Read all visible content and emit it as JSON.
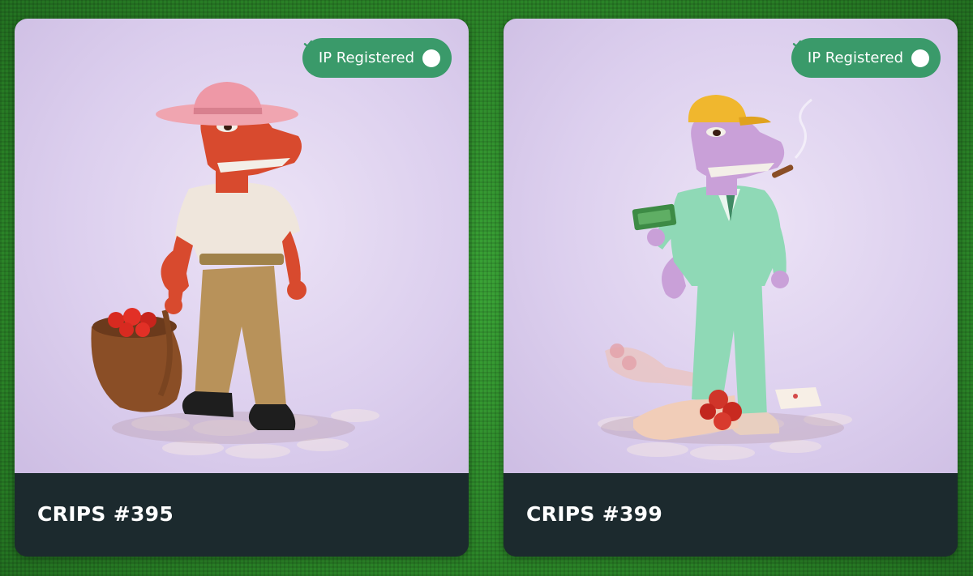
{
  "cards": [
    {
      "name": "CRIPS #395",
      "badge": {
        "label": "IP Registered",
        "icon": "check-circle-icon"
      },
      "character": {
        "skin_color": "#d84a2e",
        "outfit_color": "#efe6dc",
        "hat_color": "#f0a5b0"
      }
    },
    {
      "name": "CRIPS #399",
      "badge": {
        "label": "IP Registered",
        "icon": "check-circle-icon"
      },
      "character": {
        "skin_color": "#c9a0d8",
        "outfit_color": "#8fd9b6",
        "hat_color": "#f0b72e"
      }
    }
  ],
  "colors": {
    "background": "#2f8f2c",
    "card_footer": "#1c2a2e",
    "badge": "#3a9a6a",
    "art_background": "#ddd0ef"
  }
}
